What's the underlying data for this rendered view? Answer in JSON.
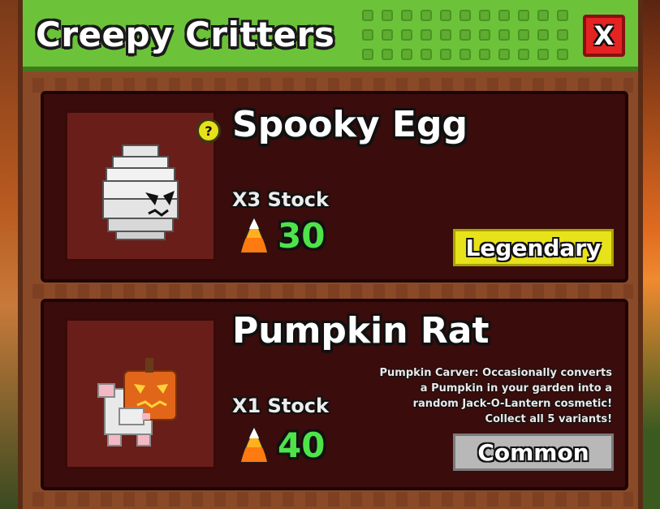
{
  "shop": {
    "title": "Creepy Critters",
    "close_label": "X"
  },
  "items": [
    {
      "name": "Spooky Egg",
      "stock": "X3 Stock",
      "price": "30",
      "rarity": "Legendary",
      "help_label": "?",
      "description": "",
      "icon": "spooky-egg-icon",
      "currency_icon": "candy-corn-icon",
      "rarity_color": "#e8e21a"
    },
    {
      "name": "Pumpkin Rat",
      "stock": "X1 Stock",
      "price": "40",
      "rarity": "Common",
      "description": "Pumpkin Carver: Occasionally converts a Pumpkin in your garden into a random Jack-O-Lantern cosmetic! Collect all 5 variants!",
      "icon": "pumpkin-rat-icon",
      "currency_icon": "candy-corn-icon",
      "rarity_color": "#b8b8b8"
    }
  ],
  "colors": {
    "header_green": "#6cc33a",
    "panel_brown": "#8a4a28",
    "card_dark": "#3a0c0c",
    "price_green": "#4fe34a"
  }
}
